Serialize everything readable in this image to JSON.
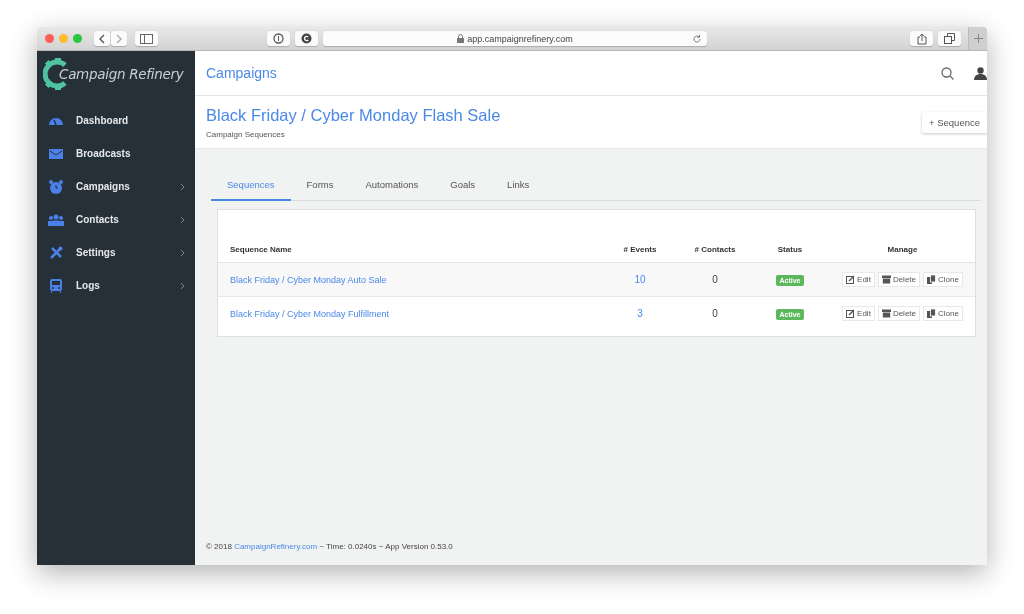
{
  "browser": {
    "url": "app.campaignrefinery.com"
  },
  "sidebar": {
    "logo": "Campaign Refinery",
    "items": [
      {
        "label": "Dashboard",
        "has_submenu": false
      },
      {
        "label": "Broadcasts",
        "has_submenu": false
      },
      {
        "label": "Campaigns",
        "has_submenu": true
      },
      {
        "label": "Contacts",
        "has_submenu": true
      },
      {
        "label": "Settings",
        "has_submenu": true
      },
      {
        "label": "Logs",
        "has_submenu": true
      }
    ]
  },
  "topbar": {
    "title": "Campaigns"
  },
  "header": {
    "title": "Black Friday / Cyber Monday Flash Sale",
    "subtitle": "Campaign Sequences",
    "button": "+ Sequence"
  },
  "tabs": [
    {
      "label": "Sequences",
      "selected": true
    },
    {
      "label": "Forms",
      "selected": false
    },
    {
      "label": "Automations",
      "selected": false
    },
    {
      "label": "Goals",
      "selected": false
    },
    {
      "label": "Links",
      "selected": false
    }
  ],
  "table": {
    "columns": [
      "Sequence Name",
      "# Events",
      "# Contacts",
      "Status",
      "Manage"
    ],
    "rows": [
      {
        "name": "Black Friday / Cyber Monday Auto Sale",
        "events": "10",
        "contacts": "0",
        "status": "Active",
        "actions": [
          "Edit",
          "Delete",
          "Clone"
        ]
      },
      {
        "name": "Black Friday / Cyber Monday Fulfillment",
        "events": "3",
        "contacts": "0",
        "status": "Active",
        "actions": [
          "Edit",
          "Delete",
          "Clone"
        ]
      }
    ]
  },
  "footer": {
    "prefix": "© 2018 ",
    "link": "CampaignRefinery.com",
    "suffix": " ~ Time: 0.0240s ~ App Version 0.53.0"
  }
}
